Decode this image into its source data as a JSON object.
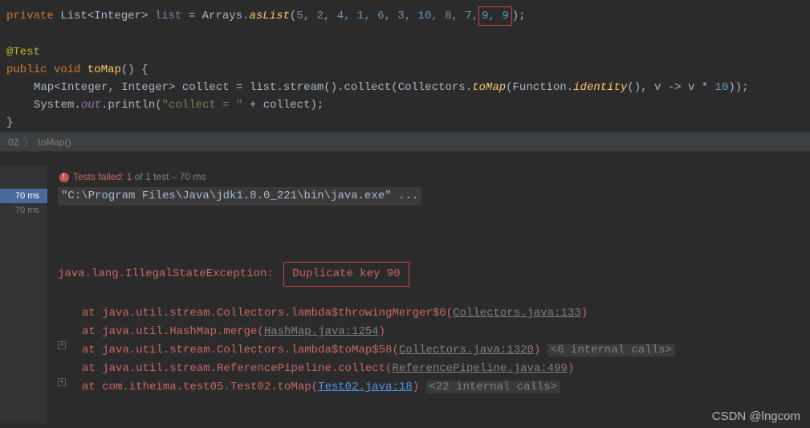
{
  "code": {
    "l1_private": "private",
    "l1_type": "List<Integer>",
    "l1_field": "list",
    "l1_eq": " = Arrays.",
    "l1_method": "asList",
    "l1_args_a": "5, 2, 4, 1, 6, 3, 10, 8, 7,",
    "l1_args_box": " 9, 9",
    "l2_annotation": "@Test",
    "l3_public": "public",
    "l3_void": "void",
    "l3_name": "toMap",
    "l4_type": "Map<Integer, Integer>",
    "l4_var": "collect = list.stream().collect(Collectors.",
    "l4_toMap": "toMap",
    "l4_args1": "(Function.",
    "l4_identity": "identity",
    "l4_args2": "(), v -> v * ",
    "l4_ten": "10",
    "l5_sys": "System.",
    "l5_out": "out",
    "l5_print": ".println(",
    "l5_str": "\"collect = \"",
    "l5_plus": " + collect);"
  },
  "breadcrumb": {
    "class": "02",
    "method": "toMap()"
  },
  "gutter": {
    "t1": "70 ms",
    "t2": "70 ms"
  },
  "status": {
    "label": "Tests failed: ",
    "failcount": "1",
    "rest": " of 1 test – 70 ms"
  },
  "console": {
    "cmd": "\"C:\\Program Files\\Java\\jdk1.8.0_221\\bin\\java.exe\" ...",
    "exc": "java.lang.IllegalStateException:",
    "exc_msg": "Duplicate key 90",
    "s1a": "at java.util.stream.Collectors.lambda$throwingMerger$0(",
    "s1b": "Collectors.java:133",
    "s2a": "at java.util.HashMap.merge(",
    "s2b": "HashMap.java:1254",
    "s3a": "at java.util.stream.Collectors.lambda$toMap$58(",
    "s3b": "Collectors.java:1320",
    "s3c": "<6 internal calls>",
    "s4a": "at java.util.stream.ReferencePipeline.collect(",
    "s4b": "ReferencePipeline.java:499",
    "s5a": "at com.itheima.test05.Test02.toMap(",
    "s5b": "Test02.java:18",
    "s5c": "<22 internal calls>"
  },
  "watermark": "CSDN @lngcom"
}
